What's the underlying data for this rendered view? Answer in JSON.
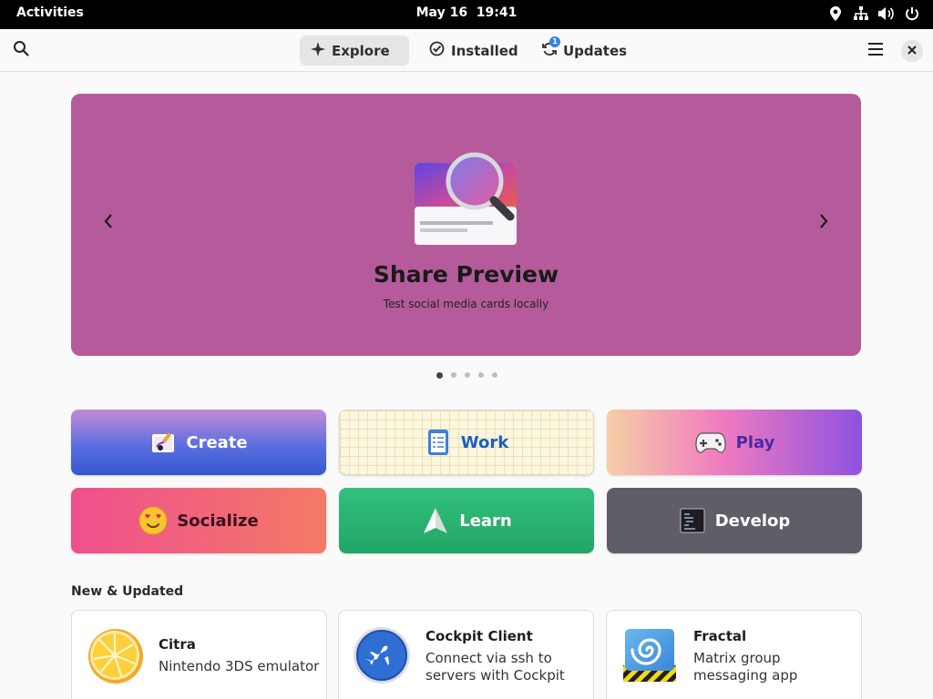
{
  "topbar": {
    "activities": "Activities",
    "clock": "May 16  19:41",
    "tray_icons": [
      "location-icon",
      "network-icon",
      "volume-icon",
      "power-icon"
    ]
  },
  "header": {
    "tabs": [
      {
        "label": "Explore",
        "icon": "explore-sparkle-icon",
        "active": true
      },
      {
        "label": "Installed",
        "icon": "check-circle-icon",
        "active": false
      },
      {
        "label": "Updates",
        "icon": "refresh-icon",
        "active": false,
        "badge": "1"
      }
    ]
  },
  "carousel": {
    "featured_name": "Share Preview",
    "featured_summary": "Test social media cards locally",
    "background_color": "#b55b9c",
    "slide_count": 5,
    "active_slide": 1
  },
  "categories": [
    {
      "label": "Create",
      "icon": "create-icon"
    },
    {
      "label": "Work",
      "icon": "work-checklist-icon"
    },
    {
      "label": "Play",
      "icon": "gamepad-icon"
    },
    {
      "label": "Socialize",
      "icon": "heart-eyes-emoji-icon"
    },
    {
      "label": "Learn",
      "icon": "paper-plane-icon"
    },
    {
      "label": "Develop",
      "icon": "terminal-icon"
    }
  ],
  "new_updated": {
    "title": "New & Updated",
    "apps": [
      {
        "name": "Citra",
        "description": "Nintendo 3DS emulator",
        "icon": "citra-orange-icon"
      },
      {
        "name": "Cockpit Client",
        "description": "Connect via ssh to servers with Cockpit",
        "icon": "cockpit-airplane-icon"
      },
      {
        "name": "Fractal",
        "description": "Matrix group messaging app",
        "icon": "fractal-icon"
      }
    ]
  },
  "colors": {
    "accent": "#3584e4",
    "topbar": "#000000",
    "window_bg": "#fafafa"
  }
}
